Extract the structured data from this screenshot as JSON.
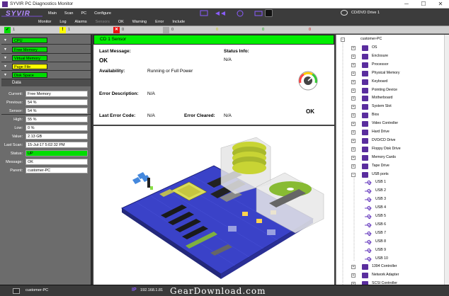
{
  "window": {
    "title": "SYVIR PC Diagnostics Monitor",
    "min": "─",
    "max": "☐",
    "close": "✕"
  },
  "menu": [
    "Main",
    "Scan",
    "PC",
    "Configure"
  ],
  "toolbar": {
    "items": [
      "Monitor",
      "Log",
      "Alarms",
      "Sensors",
      "OK",
      "Warning",
      "Error",
      "Include"
    ],
    "device": "CD/DVD Drive 1"
  },
  "status_strip": {
    "ok_count": "1",
    "warn_count": "1",
    "err_count": "0",
    "gray_count": "0",
    "warn_num2": "0",
    "ok_num2": "0",
    "err_num2": "0"
  },
  "indicators": [
    {
      "label": "CPU",
      "color": "#00dd00"
    },
    {
      "label": "Free Memory",
      "color": "#00dd00"
    },
    {
      "label": "Virtual Memory",
      "color": "#00dd00"
    },
    {
      "label": "Page File",
      "color": "#ffff00"
    },
    {
      "label": "Disk Space",
      "color": "#00dd00"
    }
  ],
  "data_panel": {
    "header": "Data",
    "rows": [
      {
        "label": "Current:",
        "value": "Free Memory",
        "color": "#ffffff"
      },
      {
        "label": "Previous:",
        "value": "54 %",
        "color": "#ffffff"
      },
      {
        "label": "Sensor:",
        "value": "54 %",
        "color": "#ffffff"
      },
      {
        "label": "High:",
        "value": "55 %",
        "color": "#ffffff"
      },
      {
        "label": "Low:",
        "value": "0 %",
        "color": "#ffffff"
      },
      {
        "label": "Value:",
        "value": "2.13 GB",
        "color": "#ffffff"
      },
      {
        "label": "Last Scan:",
        "value": "15-Jul-17 5:02:32 PM",
        "color": "#ffffff"
      },
      {
        "label": "Status:",
        "value": "UP",
        "color": "#00dd00"
      },
      {
        "label": "Message:",
        "value": "OK",
        "color": "#ffffff"
      },
      {
        "label": "Parent:",
        "value": "customer-PC",
        "color": "#ffffff"
      }
    ]
  },
  "sensor": {
    "header": "CD 1 Sensor",
    "last_message_label": "Last Message:",
    "last_message": "OK",
    "status_info_label": "Status Info:",
    "status_info": "N/A",
    "availability_label": "Availability:",
    "availability": "Running or Full Power",
    "error_desc_label": "Error Description:",
    "error_desc": "N/A",
    "last_error_code_label": "Last Error Code:",
    "last_error_code": "N/A",
    "error_cleared_label": "Error Cleared:",
    "error_cleared": "N/A",
    "gauge_status": "OK"
  },
  "tree": {
    "root": "customer-PC",
    "items": [
      "OS",
      "Enclosure",
      "Processor",
      "Physical Memory",
      "Keyboard",
      "Pointing Device",
      "Motherboard",
      "System Slot",
      "Bios",
      "Video Controller",
      "Hard Drive",
      "DVD/CD Drive",
      "Floppy Disk Drive",
      "Memory Cards",
      "Tape Drive",
      "USB ports"
    ],
    "usb": [
      "USB 1",
      "USB 2",
      "USB 3",
      "USB 4",
      "USB 5",
      "USB 6",
      "USB 7",
      "USB 8",
      "USB 9",
      "USB 10"
    ],
    "after": [
      "1394 Controller",
      "Network Adapter",
      "SCSI Controller"
    ]
  },
  "bottom": {
    "host": "customer-PC",
    "ip_label": "IP",
    "ip": "192.168.1.81"
  },
  "watermark": "GearDownload.com"
}
